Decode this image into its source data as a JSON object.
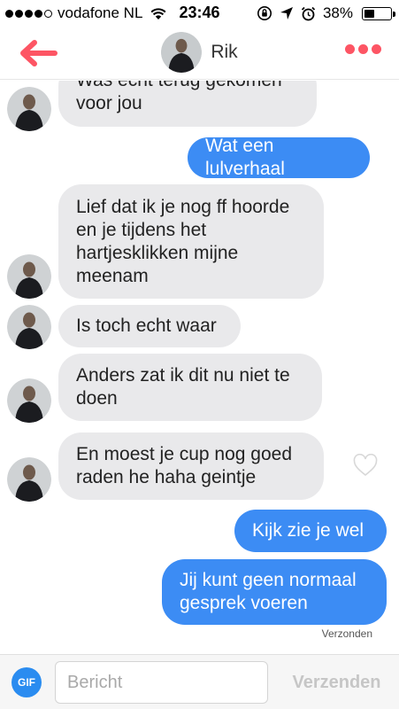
{
  "status_bar": {
    "carrier": "vodafone NL",
    "time": "23:46",
    "battery_percent": "38%",
    "battery_level": 0.38,
    "signal_bars_filled": 4,
    "signal_bars_total": 5
  },
  "header": {
    "contact_name": "Rik",
    "back_icon": "back-arrow-icon",
    "more_icon": "more-dots-icon",
    "accent_color": "#fd5564"
  },
  "messages": [
    {
      "direction": "in",
      "text_lines": [
        "Was echt terug gekomen",
        "voor jou"
      ]
    },
    {
      "direction": "out",
      "text_lines": [
        "Wat een lulverhaal"
      ]
    },
    {
      "direction": "in",
      "text_lines": [
        "Lief dat ik je nog ff hoorde",
        "en je tijdens het",
        "hartjesklikken mijne",
        "meenam"
      ]
    },
    {
      "direction": "in",
      "text_lines": [
        "Is toch echt waar"
      ]
    },
    {
      "direction": "in",
      "text_lines": [
        "Anders zat ik dit nu niet te",
        "doen"
      ]
    },
    {
      "direction": "in",
      "text_lines": [
        "En moest je cup nog goed",
        "raden he haha geintje"
      ]
    },
    {
      "direction": "out",
      "text_lines": [
        "Kijk zie je wel"
      ]
    },
    {
      "direction": "out",
      "text_lines": [
        "Jij kunt geen normaal",
        "gesprek voeren"
      ]
    }
  ],
  "delivery_status": "Verzonden",
  "composer": {
    "gif_label": "GIF",
    "placeholder": "Bericht",
    "value": "",
    "send_label": "Verzenden"
  },
  "colors": {
    "outgoing_bubble": "#3c8cf4",
    "incoming_bubble": "#e9e9eb",
    "gif_button": "#2a8cf0"
  }
}
